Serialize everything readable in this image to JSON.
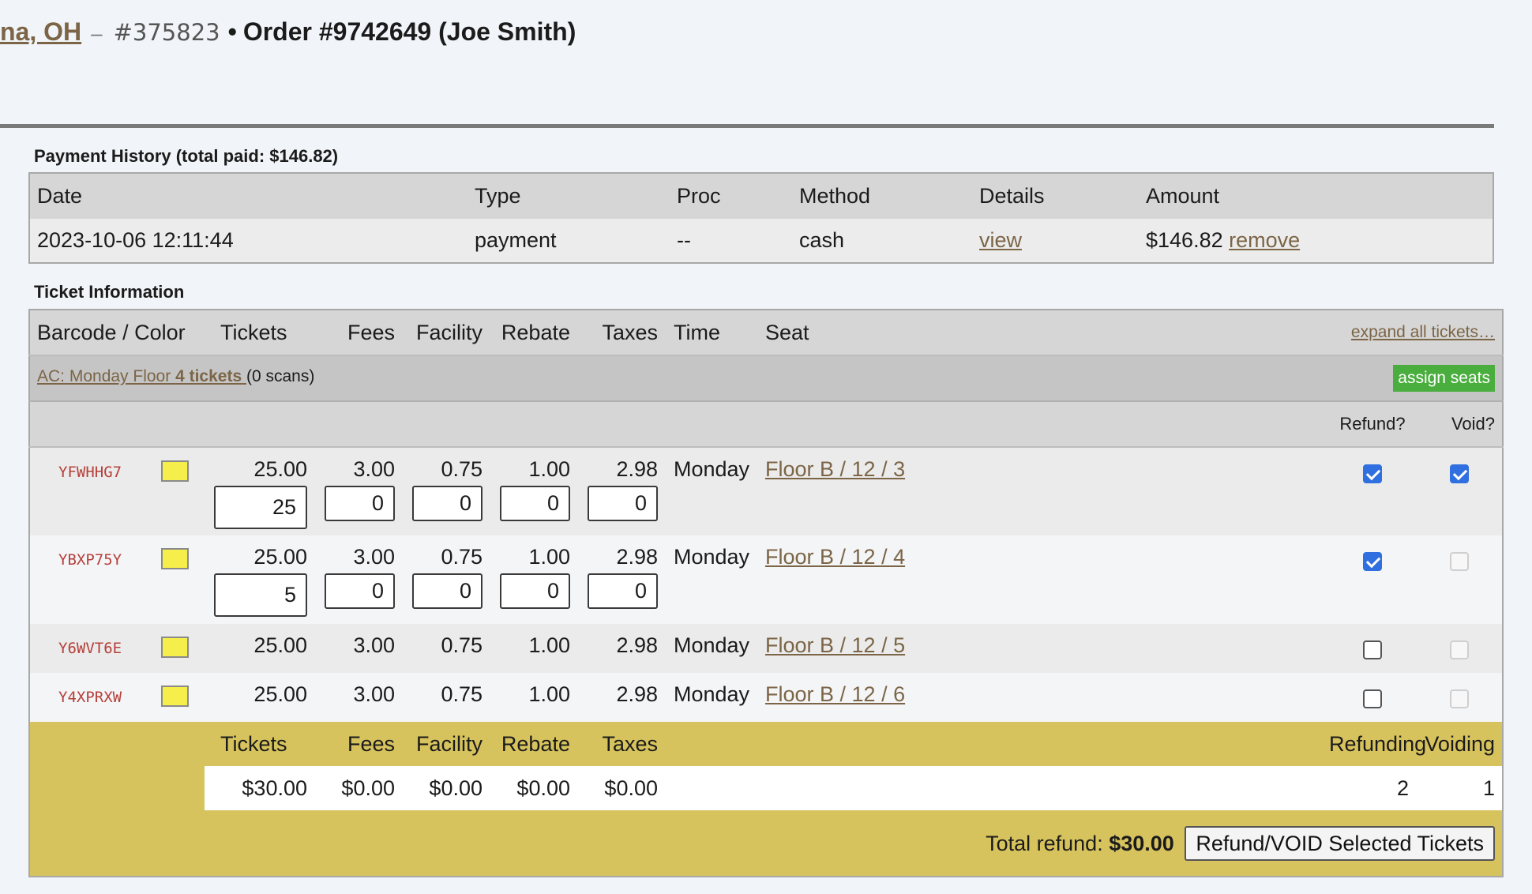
{
  "header": {
    "venue_link": "na, OH",
    "separator": "–",
    "event_id": "#375823",
    "dot": "•",
    "order_title": "Order #9742649 (Joe Smith)"
  },
  "payment_history": {
    "title": "Payment History (total paid: $146.82)",
    "columns": [
      "Date",
      "Type",
      "Proc",
      "Method",
      "Details",
      "Amount"
    ],
    "rows": [
      {
        "date": "2023-10-06 12:11:44",
        "type": "payment",
        "proc": "--",
        "method": "cash",
        "details_link": "view",
        "amount": "$146.82",
        "remove_link": "remove"
      }
    ]
  },
  "ticket_info": {
    "title": "Ticket Information",
    "columns": [
      "Barcode / Color",
      "Tickets",
      "Fees",
      "Facility",
      "Rebate",
      "Taxes",
      "Time",
      "Seat"
    ],
    "expand_link": "expand all tickets…",
    "group": {
      "link_prefix": "AC: Monday Floor ",
      "link_count": "4 tickets",
      "scans": "(0 scans)",
      "assign_button": "assign seats"
    },
    "refund_header": "Refund?",
    "void_header": "Void?",
    "swatch_color": "#f6ef4b",
    "tickets": [
      {
        "barcode": "YFWHHG7",
        "tickets": "25.00",
        "fees": "3.00",
        "facility": "0.75",
        "rebate": "1.00",
        "taxes": "2.98",
        "time": "Monday",
        "seat": "Floor B / 12 / 3",
        "edit": {
          "tickets": "25",
          "fees": "0",
          "facility": "0",
          "rebate": "0",
          "taxes": "0"
        },
        "refund": true,
        "void": true
      },
      {
        "barcode": "YBXP75Y",
        "tickets": "25.00",
        "fees": "3.00",
        "facility": "0.75",
        "rebate": "1.00",
        "taxes": "2.98",
        "time": "Monday",
        "seat": "Floor B / 12 / 4",
        "edit": {
          "tickets": "5",
          "fees": "0",
          "facility": "0",
          "rebate": "0",
          "taxes": "0"
        },
        "refund": true,
        "void": false
      },
      {
        "barcode": "Y6WVT6E",
        "tickets": "25.00",
        "fees": "3.00",
        "facility": "0.75",
        "rebate": "1.00",
        "taxes": "2.98",
        "time": "Monday",
        "seat": "Floor B / 12 / 5",
        "refund": false,
        "void": false
      },
      {
        "barcode": "Y4XPRXW",
        "tickets": "25.00",
        "fees": "3.00",
        "facility": "0.75",
        "rebate": "1.00",
        "taxes": "2.98",
        "time": "Monday",
        "seat": "Floor B / 12 / 6",
        "refund": false,
        "void": false
      }
    ]
  },
  "summary": {
    "columns": [
      "Tickets",
      "Fees",
      "Facility",
      "Rebate",
      "Taxes"
    ],
    "values": [
      "$30.00",
      "$0.00",
      "$0.00",
      "$0.00",
      "$0.00"
    ],
    "refunding_label": "Refunding",
    "voiding_label": "Voiding",
    "refunding_count": "2",
    "voiding_count": "1",
    "total_label": "Total refund:",
    "total_value": "$30.00",
    "submit_button": "Refund/VOID Selected Tickets"
  }
}
